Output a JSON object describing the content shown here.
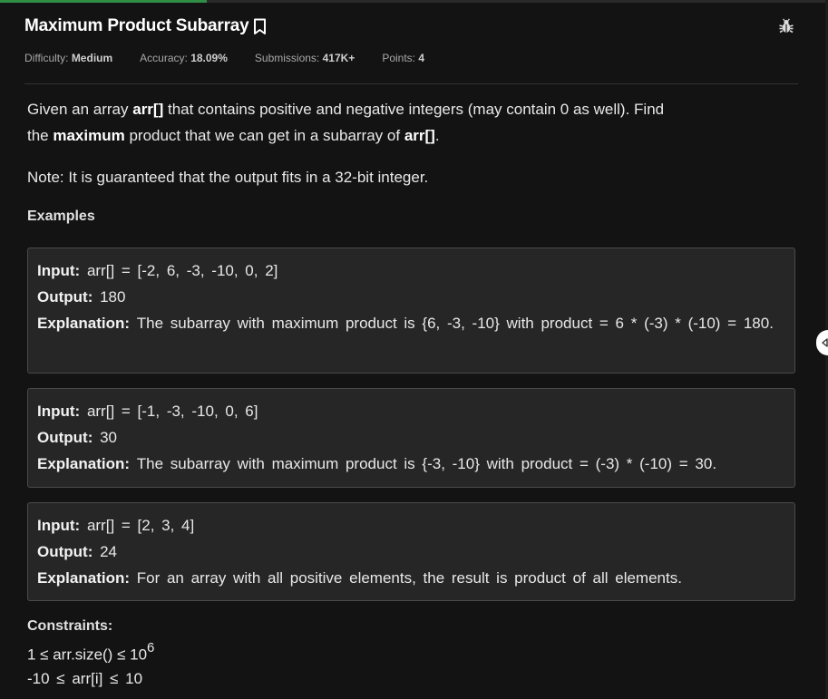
{
  "problem": {
    "title": "Maximum Product Subarray",
    "meta": {
      "difficulty_label": "Difficulty:",
      "difficulty_value": "Medium",
      "accuracy_label": "Accuracy:",
      "accuracy_value": "18.09%",
      "submissions_label": "Submissions:",
      "submissions_value": "417K+",
      "points_label": "Points:",
      "points_value": "4"
    },
    "description": {
      "p1": "Given an array ",
      "p1_bold": "arr[]",
      "p2": " that contains positive and negative integers (may contain 0 as well). Find the ",
      "p2_bold": "maximum",
      "p3": " product that we can get in a subarray of ",
      "p3_bold": "arr[]",
      "p4": "."
    },
    "note": "Note: It is guaranteed that the output fits in a 32-bit integer.",
    "examples_heading": "Examples",
    "examples": [
      {
        "input_label": "Input:",
        "input": "arr[] = [-2, 6, -3, -10, 0, 2]",
        "output_label": "Output:",
        "output": "180",
        "explanation_label": "Explanation:",
        "explanation": "The subarray with maximum product is {6, -3, -10} with product = 6 * (-3) * (-10) = 180."
      },
      {
        "input_label": "Input:",
        "input": "arr[] = [-1, -3, -10, 0, 6]",
        "output_label": "Output:",
        "output": "30",
        "explanation_label": "Explanation:",
        "explanation": "The subarray with maximum product is {-3, -10} with product = (-3) * (-10) = 30."
      },
      {
        "input_label": "Input:",
        "input": "arr[] = [2, 3, 4]",
        "output_label": "Output:",
        "output": "24",
        "explanation_label": "Explanation:",
        "explanation": "For an array with all positive elements, the result is product of all elements."
      }
    ],
    "constraints_heading": "Constraints:",
    "constraints": {
      "c1_prefix": "1 ≤ arr.size() ≤ 10",
      "c1_exp": "6",
      "c2": "-10 ≤ arr[i] ≤ 10"
    }
  },
  "icons": {
    "bookmark": "bookmark-icon",
    "bug": "bug-icon",
    "collapse": "chevron-left-icon"
  },
  "colors": {
    "background": "#131313",
    "example_bg": "#262626",
    "progress": "#2f8d46"
  },
  "progress_fraction": 0.25
}
